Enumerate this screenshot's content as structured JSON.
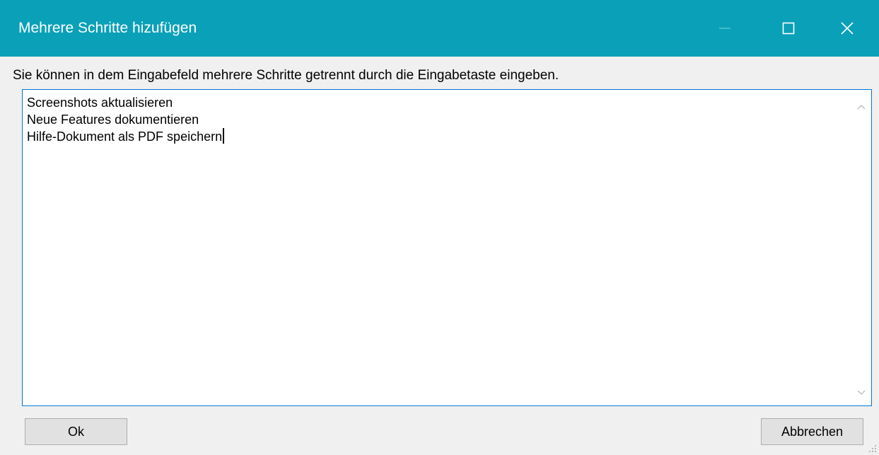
{
  "window": {
    "title": "Mehrere Schritte hizufügen",
    "controls": {
      "minimize_icon": "minimize-icon",
      "maximize_icon": "maximize-icon",
      "close_icon": "close-icon"
    },
    "titlebar_color": "#0aa0b8"
  },
  "dialog": {
    "instruction": "Sie können in dem Eingabefeld mehrere Schritte getrennt durch die Eingabetaste eingeben.",
    "steps_input": {
      "lines": [
        "Screenshots aktualisieren",
        "Neue Features dokumentieren",
        "Hilfe-Dokument als PDF speichern"
      ],
      "focus_color": "#0078d7"
    },
    "buttons": {
      "ok_label": "Ok",
      "cancel_label": "Abbrechen"
    }
  }
}
